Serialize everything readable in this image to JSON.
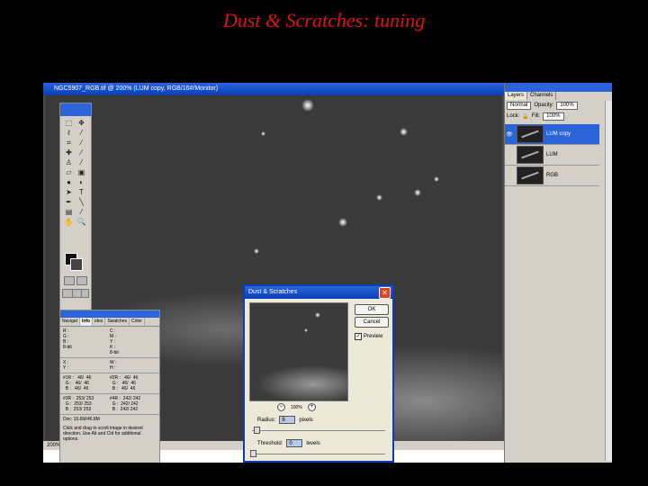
{
  "slide": {
    "title": "Dust & Scratches: tuning"
  },
  "document": {
    "title": "NGC5907_RGB.tif @ 200% (LUM  copy, RGB/16#/Monitor)",
    "zoom": "200%"
  },
  "toolbox": {
    "tools": [
      "marquee-icon",
      "move-icon",
      "lasso-icon",
      "magic-wand-icon",
      "crop-icon",
      "slice-icon",
      "healing-icon",
      "brush-icon",
      "stamp-icon",
      "history-brush-icon",
      "eraser-icon",
      "gradient-icon",
      "blur-icon",
      "dodge-icon",
      "path-select-icon",
      "type-icon",
      "pen-icon",
      "line-icon",
      "notes-icon",
      "eyedropper-icon",
      "hand-icon",
      "zoom-icon"
    ]
  },
  "info_palette": {
    "tabs": [
      "Navigat",
      "Info",
      "ides",
      "Swatches",
      "Color"
    ],
    "active_tab": "Info",
    "rgb_left": "R :\nG :\nB :\n8-bit",
    "cmyk_right": "C :\nM :\nY :\nK :\n8-bit",
    "xy_left": "X :\nY :",
    "wh_right": "W :\nH :",
    "s1_left": "#1R :   46/  46\n  G :   46/  46\n  B :   46/  46",
    "s1_right": "#2R :   46/  46\n  G :   46/  46\n  B :   46/  46",
    "s2_left": "#3R :  253/ 253\n  G :  253/ 253\n  B :  253/ 253",
    "s2_right": "#4R :  242/ 242\n  G :  242/ 242\n  B :  242/ 242",
    "doc": "Doc: 15.6M/46.8M",
    "help": "Click and drag to scroll image in desired direction.  Use Alt and Ctrl for additional options."
  },
  "dialog": {
    "title": "Dust & Scratches",
    "ok": "OK",
    "cancel": "Cancel",
    "preview_label": "Preview",
    "preview_checked": true,
    "zoom": "100%",
    "radius_label": "Radius:",
    "radius_value": "8",
    "radius_unit": "pixels",
    "threshold_label": "Threshold:",
    "threshold_value": "0",
    "threshold_unit": "levels"
  },
  "layers_palette": {
    "tabs": [
      "Layers",
      "Channels"
    ],
    "blend_mode": "Normal",
    "opacity_label": "Opacity:",
    "opacity_value": "100%",
    "lock_label": "Lock:",
    "fill_label": "Fill:",
    "fill_value": "100%",
    "layers": [
      {
        "name": "LUM  copy",
        "active": true
      },
      {
        "name": "LUM",
        "active": false
      },
      {
        "name": "RGB",
        "active": false
      }
    ]
  },
  "colors": {
    "titlebar": "#0a3fb6",
    "slide_title": "#e01010"
  }
}
